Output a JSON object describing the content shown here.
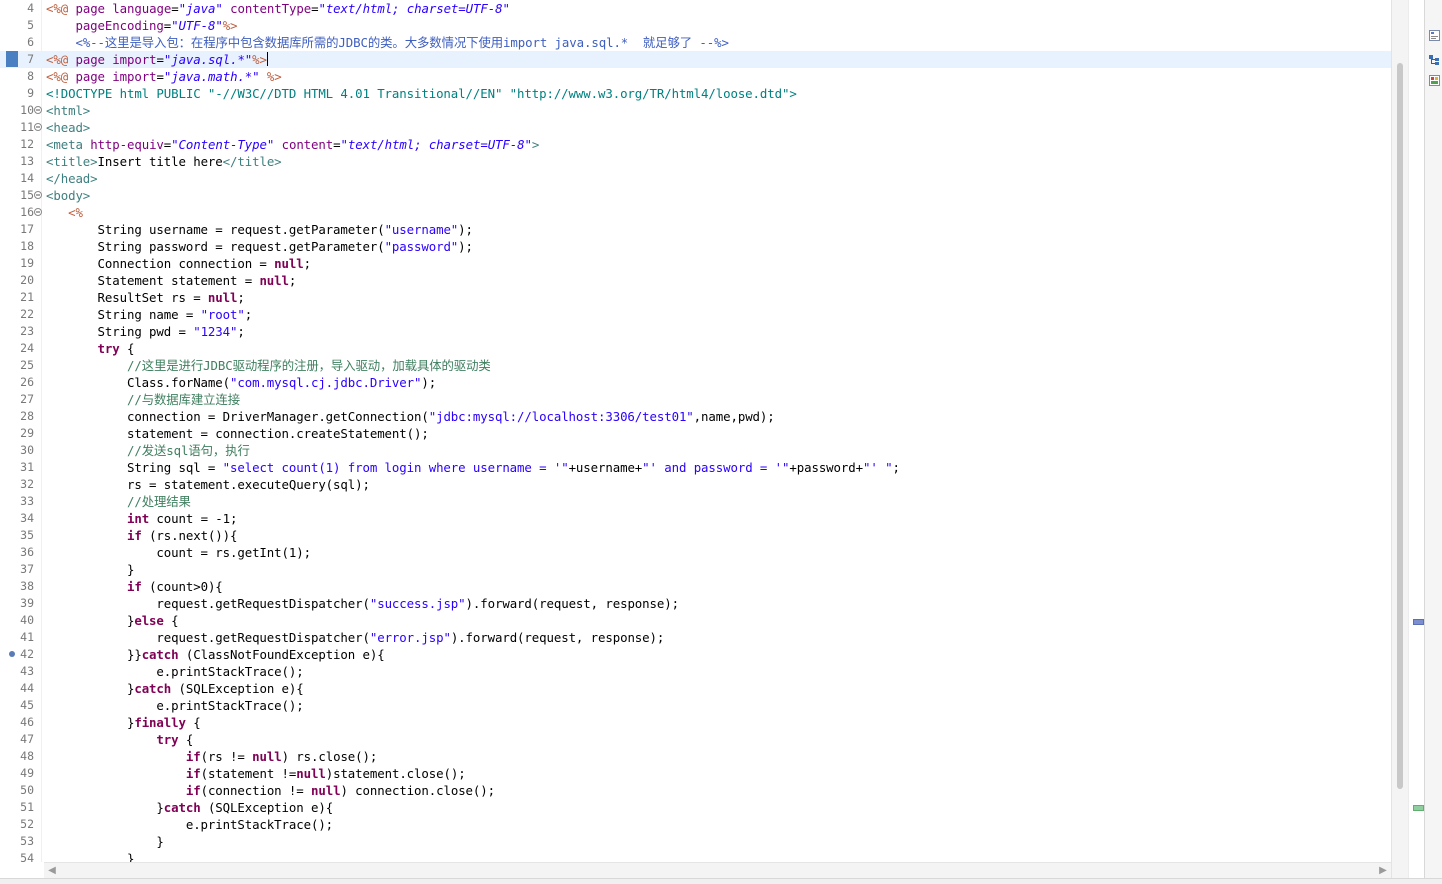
{
  "editor": {
    "current_line": 7,
    "lines": [
      {
        "n": "4",
        "tokens": [
          [
            "delim",
            "<%@"
          ],
          [
            "plain",
            " "
          ],
          [
            "attr",
            "page"
          ],
          [
            "plain",
            " "
          ],
          [
            "attr",
            "language"
          ],
          [
            "plain",
            "="
          ],
          [
            "istr",
            "\"java\""
          ],
          [
            "plain",
            " "
          ],
          [
            "attr",
            "contentType"
          ],
          [
            "plain",
            "="
          ],
          [
            "istr",
            "\"text/html; charset=UTF-8\""
          ]
        ]
      },
      {
        "n": "5",
        "tokens": [
          [
            "plain",
            "    "
          ],
          [
            "attr",
            "pageEncoding"
          ],
          [
            "plain",
            "="
          ],
          [
            "istr",
            "\"UTF-8\""
          ],
          [
            "delim",
            "%>"
          ]
        ]
      },
      {
        "n": "6",
        "tokens": [
          [
            "plain",
            "    "
          ],
          [
            "jspcmt",
            "<%--这里是导入包：在程序中包含数据库所需的JDBC的类。大多数情况下使用import java.sql.*  就足够了 --%>"
          ]
        ]
      },
      {
        "n": "7",
        "tokens": [
          [
            "delim",
            "<%@"
          ],
          [
            "plain",
            " "
          ],
          [
            "attr",
            "page"
          ],
          [
            "plain",
            " "
          ],
          [
            "attr",
            "import"
          ],
          [
            "plain",
            "="
          ],
          [
            "istr",
            "\"java.sql.*\""
          ],
          [
            "delim",
            "%>"
          ]
        ]
      },
      {
        "n": "8",
        "tokens": [
          [
            "delim",
            "<%@"
          ],
          [
            "plain",
            " "
          ],
          [
            "attr",
            "page"
          ],
          [
            "plain",
            " "
          ],
          [
            "attr",
            "import"
          ],
          [
            "plain",
            "="
          ],
          [
            "istr",
            "\"java.math.*\""
          ],
          [
            "plain",
            " "
          ],
          [
            "delim",
            "%>"
          ]
        ]
      },
      {
        "n": "9",
        "tokens": [
          [
            "dtd",
            "<!DOCTYPE html PUBLIC \"-//W3C//DTD HTML 4.01 Transitional//EN\" \"http://www.w3.org/TR/html4/loose.dtd\">"
          ]
        ]
      },
      {
        "n": "10",
        "fold": true,
        "tokens": [
          [
            "tag",
            "<html>"
          ]
        ]
      },
      {
        "n": "11",
        "fold": true,
        "tokens": [
          [
            "tag",
            "<head>"
          ]
        ]
      },
      {
        "n": "12",
        "tokens": [
          [
            "tag",
            "<meta"
          ],
          [
            "plain",
            " "
          ],
          [
            "attr",
            "http-equiv"
          ],
          [
            "plain",
            "="
          ],
          [
            "istr",
            "\"Content-Type\""
          ],
          [
            "plain",
            " "
          ],
          [
            "attr",
            "content"
          ],
          [
            "plain",
            "="
          ],
          [
            "istr",
            "\"text/html; charset=UTF-8\""
          ],
          [
            "tag",
            ">"
          ]
        ]
      },
      {
        "n": "13",
        "tokens": [
          [
            "tag",
            "<title>"
          ],
          [
            "plain",
            "Insert title here"
          ],
          [
            "tag",
            "</title>"
          ]
        ]
      },
      {
        "n": "14",
        "tokens": [
          [
            "tag",
            "</head>"
          ]
        ]
      },
      {
        "n": "15",
        "fold": true,
        "tokens": [
          [
            "tag",
            "<body>"
          ]
        ]
      },
      {
        "n": "16",
        "fold": true,
        "tokens": [
          [
            "plain",
            "   "
          ],
          [
            "delim",
            "<%"
          ]
        ]
      },
      {
        "n": "17",
        "tokens": [
          [
            "plain",
            "       String username = request.getParameter("
          ],
          [
            "str",
            "\"username\""
          ],
          [
            "plain",
            ");"
          ]
        ]
      },
      {
        "n": "18",
        "tokens": [
          [
            "plain",
            "       String password = request.getParameter("
          ],
          [
            "str",
            "\"password\""
          ],
          [
            "plain",
            ");"
          ]
        ]
      },
      {
        "n": "19",
        "tokens": [
          [
            "plain",
            "       Connection connection = "
          ],
          [
            "kw",
            "null"
          ],
          [
            "plain",
            ";"
          ]
        ]
      },
      {
        "n": "20",
        "tokens": [
          [
            "plain",
            "       Statement statement = "
          ],
          [
            "kw",
            "null"
          ],
          [
            "plain",
            ";"
          ]
        ]
      },
      {
        "n": "21",
        "tokens": [
          [
            "plain",
            "       ResultSet rs = "
          ],
          [
            "kw",
            "null"
          ],
          [
            "plain",
            ";"
          ]
        ]
      },
      {
        "n": "22",
        "tokens": [
          [
            "plain",
            "       String name = "
          ],
          [
            "str",
            "\"root\""
          ],
          [
            "plain",
            ";"
          ]
        ]
      },
      {
        "n": "23",
        "tokens": [
          [
            "plain",
            "       String pwd = "
          ],
          [
            "str",
            "\"1234\""
          ],
          [
            "plain",
            ";"
          ]
        ]
      },
      {
        "n": "24",
        "tokens": [
          [
            "plain",
            "       "
          ],
          [
            "kw",
            "try"
          ],
          [
            "plain",
            " {"
          ]
        ]
      },
      {
        "n": "25",
        "tokens": [
          [
            "plain",
            "           "
          ],
          [
            "cmt",
            "//这里是进行JDBC驱动程序的注册，导入驱动，加载具体的驱动类"
          ]
        ]
      },
      {
        "n": "26",
        "tokens": [
          [
            "plain",
            "           Class.forName("
          ],
          [
            "str",
            "\"com.mysql.cj.jdbc.Driver\""
          ],
          [
            "plain",
            ");"
          ]
        ]
      },
      {
        "n": "27",
        "tokens": [
          [
            "plain",
            "           "
          ],
          [
            "cmt",
            "//与数据库建立连接"
          ]
        ]
      },
      {
        "n": "28",
        "tokens": [
          [
            "plain",
            "           connection = DriverManager.getConnection("
          ],
          [
            "str",
            "\"jdbc:mysql://localhost:3306/test01\""
          ],
          [
            "plain",
            ",name,pwd);"
          ]
        ]
      },
      {
        "n": "29",
        "tokens": [
          [
            "plain",
            "           statement = connection.createStatement();"
          ]
        ]
      },
      {
        "n": "30",
        "tokens": [
          [
            "plain",
            "           "
          ],
          [
            "cmt",
            "//发送sql语句，执行"
          ]
        ]
      },
      {
        "n": "31",
        "tokens": [
          [
            "plain",
            "           String sql = "
          ],
          [
            "str",
            "\"select count(1) from login where username = '\""
          ],
          [
            "plain",
            "+username+"
          ],
          [
            "str",
            "\"' and password = '\""
          ],
          [
            "plain",
            "+password+"
          ],
          [
            "str",
            "\"' \""
          ],
          [
            "plain",
            ";"
          ]
        ]
      },
      {
        "n": "32",
        "tokens": [
          [
            "plain",
            "           rs = statement.executeQuery(sql);"
          ]
        ]
      },
      {
        "n": "33",
        "tokens": [
          [
            "plain",
            "           "
          ],
          [
            "cmt",
            "//处理结果"
          ]
        ]
      },
      {
        "n": "34",
        "tokens": [
          [
            "plain",
            "           "
          ],
          [
            "kw",
            "int"
          ],
          [
            "plain",
            " count = -1;"
          ]
        ]
      },
      {
        "n": "35",
        "tokens": [
          [
            "plain",
            "           "
          ],
          [
            "kw",
            "if"
          ],
          [
            "plain",
            " (rs.next()){"
          ]
        ]
      },
      {
        "n": "36",
        "tokens": [
          [
            "plain",
            "               count = rs.getInt(1);"
          ]
        ]
      },
      {
        "n": "37",
        "tokens": [
          [
            "plain",
            "           }"
          ]
        ]
      },
      {
        "n": "38",
        "tokens": [
          [
            "plain",
            "           "
          ],
          [
            "kw",
            "if"
          ],
          [
            "plain",
            " (count>0){"
          ]
        ]
      },
      {
        "n": "39",
        "tokens": [
          [
            "plain",
            "               request.getRequestDispatcher("
          ],
          [
            "str",
            "\"success.jsp\""
          ],
          [
            "plain",
            ").forward(request, response);"
          ]
        ]
      },
      {
        "n": "40",
        "tokens": [
          [
            "plain",
            "           }"
          ],
          [
            "kw",
            "else"
          ],
          [
            "plain",
            " {"
          ]
        ]
      },
      {
        "n": "41",
        "tokens": [
          [
            "plain",
            "               request.getRequestDispatcher("
          ],
          [
            "str",
            "\"error.jsp\""
          ],
          [
            "plain",
            ").forward(request, response);"
          ]
        ]
      },
      {
        "n": "42",
        "bp": true,
        "tokens": [
          [
            "plain",
            "           }}"
          ],
          [
            "kw",
            "catch"
          ],
          [
            "plain",
            " (ClassNotFoundException e){"
          ]
        ]
      },
      {
        "n": "43",
        "tokens": [
          [
            "plain",
            "               e.printStackTrace();"
          ]
        ]
      },
      {
        "n": "44",
        "tokens": [
          [
            "plain",
            "           }"
          ],
          [
            "kw",
            "catch"
          ],
          [
            "plain",
            " (SQLException e){"
          ]
        ]
      },
      {
        "n": "45",
        "tokens": [
          [
            "plain",
            "               e.printStackTrace();"
          ]
        ]
      },
      {
        "n": "46",
        "tokens": [
          [
            "plain",
            "           }"
          ],
          [
            "kw",
            "finally"
          ],
          [
            "plain",
            " {"
          ]
        ]
      },
      {
        "n": "47",
        "tokens": [
          [
            "plain",
            "               "
          ],
          [
            "kw",
            "try"
          ],
          [
            "plain",
            " {"
          ]
        ]
      },
      {
        "n": "48",
        "tokens": [
          [
            "plain",
            "                   "
          ],
          [
            "kw",
            "if"
          ],
          [
            "plain",
            "(rs != "
          ],
          [
            "kw",
            "null"
          ],
          [
            "plain",
            ") rs.close();"
          ]
        ]
      },
      {
        "n": "49",
        "tokens": [
          [
            "plain",
            "                   "
          ],
          [
            "kw",
            "if"
          ],
          [
            "plain",
            "(statement !="
          ],
          [
            "kw",
            "null"
          ],
          [
            "plain",
            ")statement.close();"
          ]
        ]
      },
      {
        "n": "50",
        "tokens": [
          [
            "plain",
            "                   "
          ],
          [
            "kw",
            "if"
          ],
          [
            "plain",
            "(connection != "
          ],
          [
            "kw",
            "null"
          ],
          [
            "plain",
            ") connection.close();"
          ]
        ]
      },
      {
        "n": "51",
        "tokens": [
          [
            "plain",
            "               }"
          ],
          [
            "kw",
            "catch"
          ],
          [
            "plain",
            " (SQLException e){"
          ]
        ]
      },
      {
        "n": "52",
        "tokens": [
          [
            "plain",
            "                   e.printStackTrace();"
          ]
        ]
      },
      {
        "n": "53",
        "tokens": [
          [
            "plain",
            "               }"
          ]
        ]
      },
      {
        "n": "54",
        "tokens": [
          [
            "plain",
            "           }"
          ]
        ]
      }
    ]
  },
  "colors": {
    "keyword": "#7f0055",
    "string": "#2a00ff",
    "comment": "#3f7f5f",
    "jsp_comment": "#3f5fbf",
    "tag": "#3f7f7f",
    "attribute": "#7f007f",
    "jsp_delimiter": "#bf5f3f",
    "current_line_bg": "#e8f2fe",
    "overview_marker_blue": "#7b8fd0",
    "overview_marker_green": "#8fcf9f"
  },
  "icons": {
    "scroll_left": "◀",
    "scroll_right": "▶",
    "right_bar": [
      "outline-icon",
      "hierarchy-icon",
      "problems-icon"
    ]
  }
}
